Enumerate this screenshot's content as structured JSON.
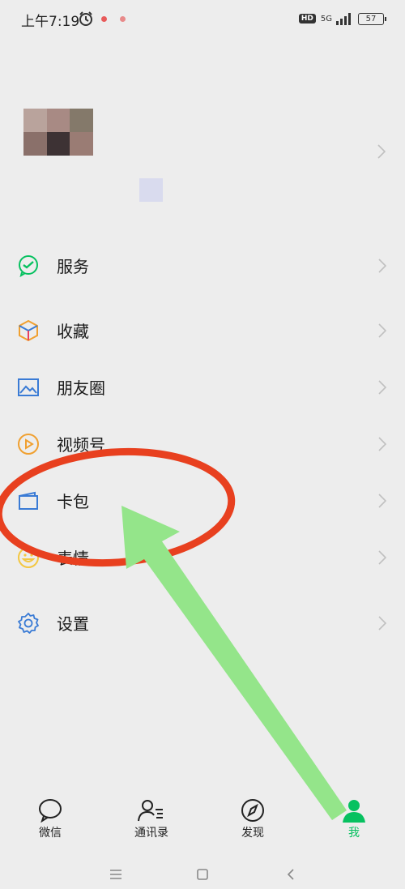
{
  "status_bar": {
    "time": "上午7:19",
    "icons": [
      "alarm-icon",
      "notification-dot",
      "notification-dot"
    ],
    "hd": "HD",
    "network": "5G",
    "battery": "57"
  },
  "profile": {
    "avatar": "avatar-blurred",
    "qr_icon": "qr-code-icon"
  },
  "menu": {
    "items": [
      {
        "id": "services",
        "label": "服务",
        "icon": "services-icon",
        "color": "#07c160"
      },
      {
        "id": "favorites",
        "label": "收藏",
        "icon": "favorites-cube-icon",
        "color": "#f0a030"
      },
      {
        "id": "moments",
        "label": "朋友圈",
        "icon": "moments-image-icon",
        "color": "#3a7bd5"
      },
      {
        "id": "channels",
        "label": "视频号",
        "icon": "channels-play-icon",
        "color": "#f0a030"
      },
      {
        "id": "cards",
        "label": "卡包",
        "icon": "cards-wallet-icon",
        "color": "#3a7bd5"
      },
      {
        "id": "stickers",
        "label": "表情",
        "icon": "stickers-smile-icon",
        "color": "#f3c742"
      },
      {
        "id": "settings",
        "label": "设置",
        "icon": "settings-gear-icon",
        "color": "#3a7bd5"
      }
    ]
  },
  "tabbar": {
    "tabs": [
      {
        "id": "chats",
        "label": "微信",
        "icon": "chat-bubble-icon",
        "active": false
      },
      {
        "id": "contacts",
        "label": "通讯录",
        "icon": "contacts-icon",
        "active": false
      },
      {
        "id": "discover",
        "label": "发现",
        "icon": "compass-icon",
        "active": false
      },
      {
        "id": "me",
        "label": "我",
        "icon": "person-icon",
        "active": true
      }
    ]
  },
  "nav": {
    "buttons": [
      "menu-icon",
      "home-square-icon",
      "back-chevron-icon"
    ]
  },
  "annotation": {
    "circle_color": "#e8401f",
    "arrow_color": "#94e58a"
  }
}
